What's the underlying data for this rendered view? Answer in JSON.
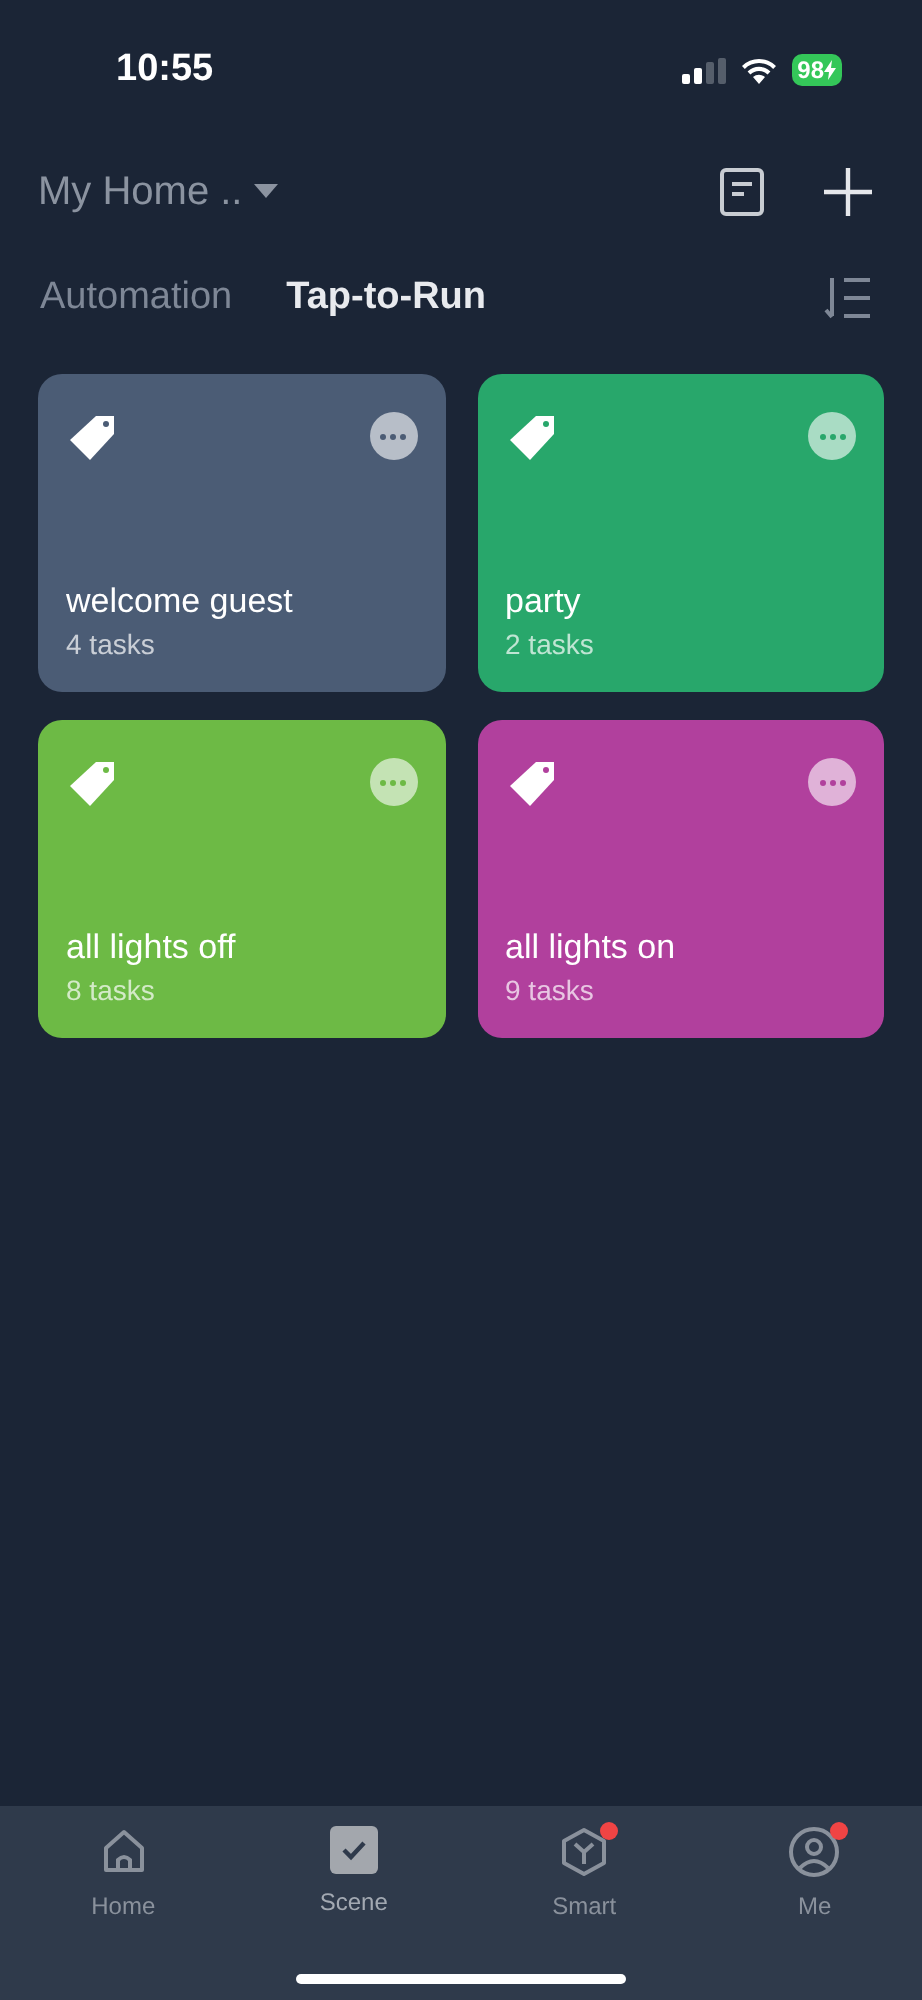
{
  "status_bar": {
    "time": "10:55",
    "battery": "98"
  },
  "header": {
    "home_name": "My Home .."
  },
  "tabs": [
    {
      "label": "Automation",
      "selected": false
    },
    {
      "label": "Tap-to-Run",
      "selected": true
    }
  ],
  "scenes": [
    {
      "name": "welcome guest",
      "tasks": "4 tasks",
      "color": "#4b5c75"
    },
    {
      "name": "party",
      "tasks": "2 tasks",
      "color": "#28a76b"
    },
    {
      "name": "all lights off",
      "tasks": "8 tasks",
      "color": "#6dba45"
    },
    {
      "name": "all lights on",
      "tasks": "9 tasks",
      "color": "#b1409d"
    }
  ],
  "nav": [
    {
      "label": "Home",
      "kind": "home",
      "selected": false,
      "badge": false
    },
    {
      "label": "Scene",
      "kind": "scene",
      "selected": true,
      "badge": false
    },
    {
      "label": "Smart",
      "kind": "smart",
      "selected": false,
      "badge": true
    },
    {
      "label": "Me",
      "kind": "me",
      "selected": false,
      "badge": true
    }
  ]
}
